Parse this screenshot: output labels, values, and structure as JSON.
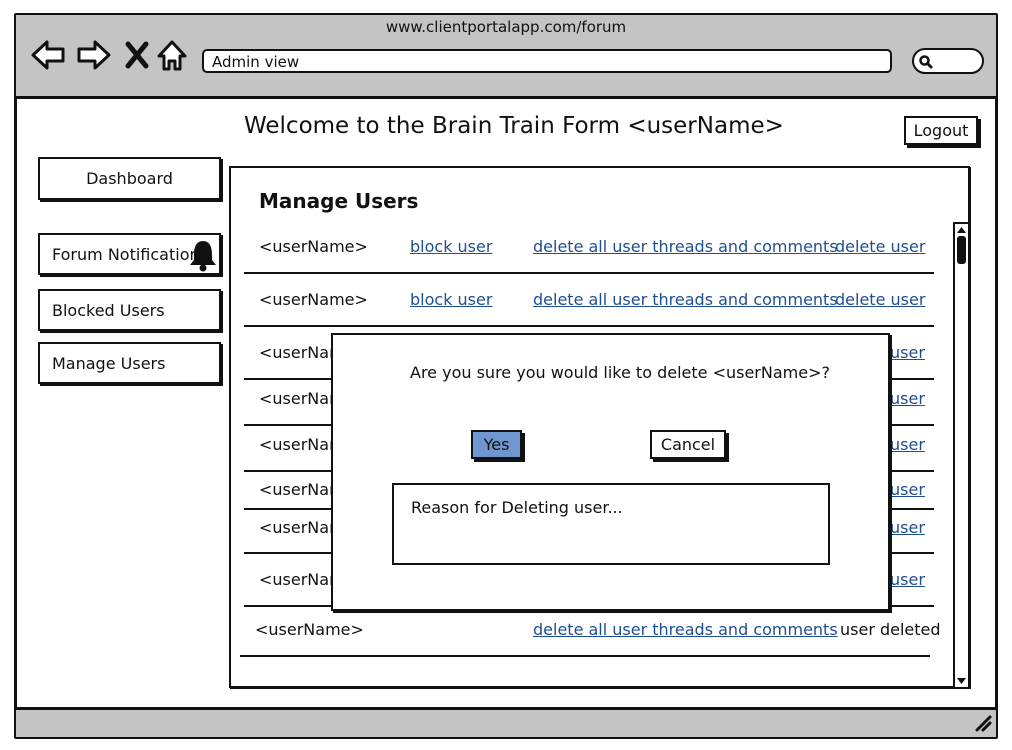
{
  "browser": {
    "url": "www.clientportalapp.com/forum",
    "address_value": "Admin view",
    "icons": [
      "back-arrow-icon",
      "forward-arrow-icon",
      "close-icon",
      "home-icon",
      "search-icon"
    ]
  },
  "header": {
    "welcome": "Welcome to the Brain Train Form <userName>",
    "logout_label": "Logout"
  },
  "sidebar": {
    "items": [
      {
        "label": "Dashboard"
      },
      {
        "label": "Forum Notifications",
        "icon": "bell-icon"
      },
      {
        "label": "Blocked Users"
      },
      {
        "label": "Manage Users"
      }
    ]
  },
  "panel": {
    "title": "Manage Users",
    "rows": [
      {
        "name": "<userName>",
        "block": "block user",
        "delete_threads": "delete all user threads and comments",
        "delete": "delete user"
      },
      {
        "name": "<userName>",
        "block": "block user",
        "delete_threads": "delete all user threads and comments",
        "delete": "delete user"
      },
      {
        "name": "<userNam",
        "delete": "user"
      },
      {
        "name": "<userNam",
        "delete": "user"
      },
      {
        "name": "<userNam",
        "delete": "user"
      },
      {
        "name": "<userNam",
        "delete": "user"
      },
      {
        "name": "<userNam",
        "delete": "user"
      },
      {
        "name": "<userNam",
        "delete": "user"
      },
      {
        "name": "<userName>",
        "delete_threads": "delete all user threads and comments",
        "status": "user deleted"
      }
    ]
  },
  "modal": {
    "question": "Are you sure you would like to delete <userName>?",
    "yes_label": "Yes",
    "cancel_label": "Cancel",
    "reason_placeholder": "Reason for Deleting user..."
  },
  "colors": {
    "chrome": "#c4c4c4",
    "link": "#1f4e91",
    "yes_button": "#6f96cf"
  }
}
